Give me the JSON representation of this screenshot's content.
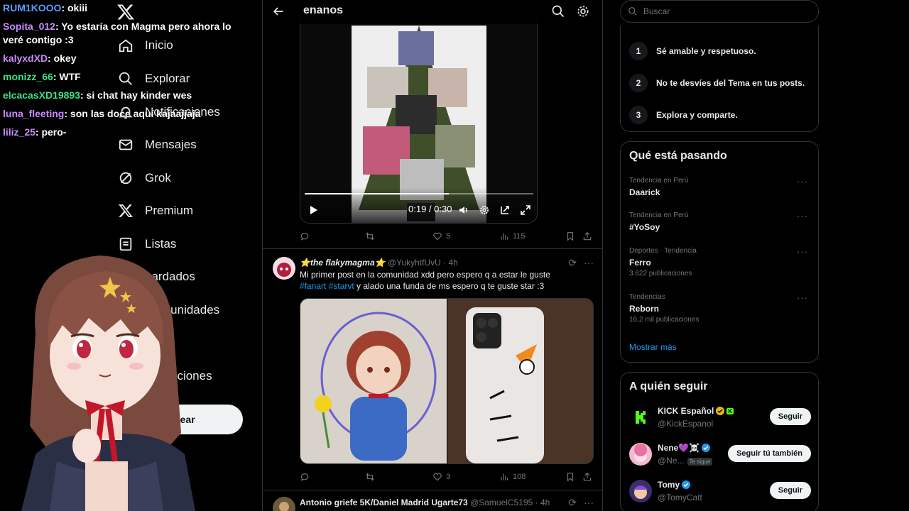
{
  "chat": {
    "messages": [
      {
        "user": "RUM1KOOO",
        "color": "#5a9bff",
        "text": ": okiii"
      },
      {
        "user": "Sopita_012",
        "color": "#c98cff",
        "text": ": Yo estaría con Magma pero ahora lo veré contigo :3"
      },
      {
        "user": "kalyxdXD",
        "color": "#c98cff",
        "text": ": okey"
      },
      {
        "user": "monizz_66",
        "color": "#3ee089",
        "text": ": WTF"
      },
      {
        "user": "elcacasXD19893",
        "color": "#3ee089",
        "text": ": si chat hay kinder wes"
      },
      {
        "user": "luna_fleeting",
        "color": "#c98cff",
        "text": ": son las doce aquí kajaajjaja"
      },
      {
        "user": "liliz_25",
        "color": "#c98cff",
        "text": ": pero-"
      }
    ]
  },
  "nav": {
    "items": [
      {
        "label": "Inicio",
        "icon": "home-icon"
      },
      {
        "label": "Explorar",
        "icon": "search-icon"
      },
      {
        "label": "Notificaciones",
        "icon": "bell-icon"
      },
      {
        "label": "Mensajes",
        "icon": "mail-icon"
      },
      {
        "label": "Grok",
        "icon": "grok-icon"
      },
      {
        "label": "Premium",
        "icon": "x-logo-icon"
      },
      {
        "label": "Listas",
        "icon": "list-icon"
      },
      {
        "label": "Guardados",
        "icon": "bookmark-icon"
      },
      {
        "label": "Comunidades",
        "icon": "people-icon"
      },
      {
        "label": "Más opciones",
        "icon": "more-icon"
      }
    ],
    "visible_labels": {
      "guardados": "uardados",
      "comunidades": "munidades",
      "opciones": "pciones"
    },
    "post_button": "Postear"
  },
  "topbar": {
    "title": "enanos"
  },
  "video_post": {
    "time": "0:19 / 0:30",
    "progress": 0.63,
    "likes": "5",
    "views": "115"
  },
  "post2": {
    "name": "⭐the flakymagma⭐",
    "handle": "@YukyhtfUvU",
    "time": "· 4h",
    "text1": "Mi primer post en la comunidad xdd pero espero q a estar le guste",
    "tag1": "#fanart",
    "tag2": "#starvt",
    "text2": " y alado una funda de ms espero q te guste star :3",
    "likes": "3",
    "views": "108"
  },
  "post3": {
    "name": "Antonio griefe 5K/Daniel Madrid Ugarte73",
    "handle": "@SamuelC5195",
    "time": "· 4h"
  },
  "right": {
    "search_placeholder": "Buscar",
    "rules": [
      {
        "n": "1",
        "text": "Sé amable y respetuoso."
      },
      {
        "n": "2",
        "text": "No te desvíes del Tema en tus posts."
      },
      {
        "n": "3",
        "text": "Explora y comparte."
      }
    ],
    "trends_title": "Qué está pasando",
    "trends": [
      {
        "ctx": "Tendencia en Perú",
        "name": "Daarick",
        "count": ""
      },
      {
        "ctx": "Tendencia en Perú",
        "name": "#YoSoy",
        "count": ""
      },
      {
        "ctx": "Deportes · Tendencia",
        "name": "Ferro",
        "count": "3.622 publicaciones"
      },
      {
        "ctx": "Tendencias",
        "name": "Reborn",
        "count": "16,2 mil publicaciones"
      }
    ],
    "show_more": "Mostrar más",
    "follow_title": "A quién seguir",
    "follows": [
      {
        "name": "KICK Español",
        "handle": "@KickEspanol",
        "button": "Seguir",
        "badge": ""
      },
      {
        "name": "Nene💜☠️",
        "handle": "@Ne...",
        "button": "Seguir tú también",
        "badge": "Te sigue"
      },
      {
        "name": "Tomy",
        "handle": "@TomyCatt",
        "button": "Seguir",
        "badge": ""
      }
    ]
  },
  "colors": {
    "accent": "#1d9bf0",
    "border": "#2f3336",
    "muted": "#71767b"
  }
}
